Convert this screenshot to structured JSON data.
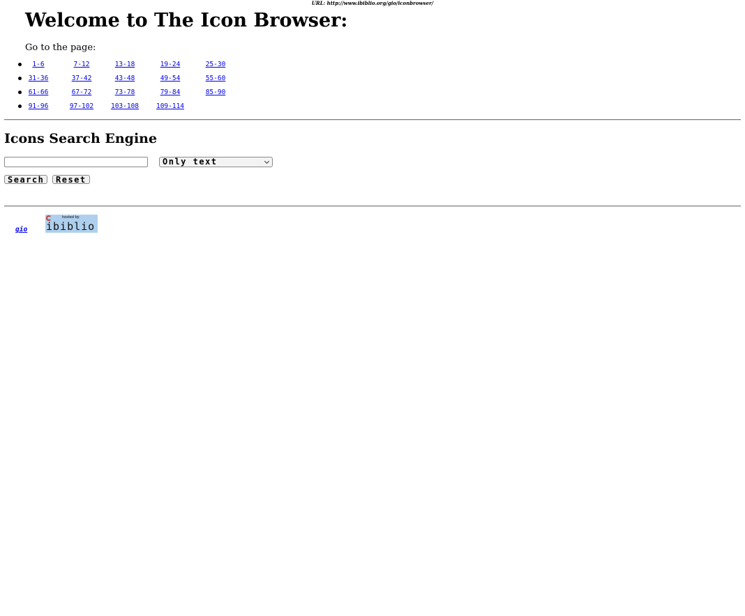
{
  "url_line": "URL: http://www.ibiblio.org/gio/iconbrowser/",
  "page_title": "Welcome to The Icon Browser:",
  "goto_label": "Go to the page:",
  "page_rows": [
    [
      "1-6",
      "7-12",
      "13-18",
      "19-24",
      "25-30"
    ],
    [
      "31-36",
      "37-42",
      "43-48",
      "49-54",
      "55-60"
    ],
    [
      "61-66",
      "67-72",
      "73-78",
      "79-84",
      "85-90"
    ],
    [
      "91-96",
      "97-102",
      "103-108",
      "109-114"
    ]
  ],
  "search": {
    "heading": "Icons Search Engine",
    "input_value": "",
    "mode_selected": "Only text",
    "search_label": "Search",
    "reset_label": "Reset"
  },
  "footer": {
    "gio_link": "gio",
    "badge_hosted": "hosted by",
    "badge_word": "ibiblio"
  }
}
